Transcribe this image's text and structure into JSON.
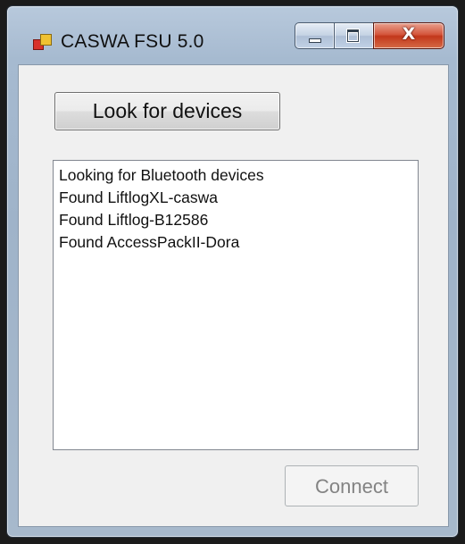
{
  "window": {
    "title": "CASWA FSU 5.0",
    "icon": "app-window-icon",
    "controls": {
      "minimize_icon": "minimize-icon",
      "maximize_icon": "maximize-icon",
      "close_icon": "close-icon",
      "close_glyph": "X"
    },
    "accent_color": "#c2371b"
  },
  "main": {
    "look_button_label": "Look for devices",
    "log_lines": [
      "Looking for Bluetooth devices",
      "Found LiftlogXL-caswa",
      "Found Liftlog-B12586",
      "Found AccessPackII-Dora"
    ],
    "connect_button_label": "Connect",
    "connect_button_enabled": false
  }
}
